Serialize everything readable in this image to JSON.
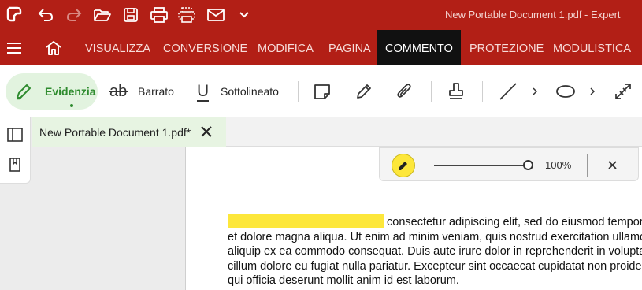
{
  "titlebar": {
    "document_title": "New Portable Document 1.pdf   -   Expert",
    "icons": [
      "app-logo-icon",
      "undo-icon",
      "redo-icon",
      "open-folder-icon",
      "save-icon",
      "print-icon",
      "scan-icon",
      "email-icon",
      "chevron-down-icon"
    ]
  },
  "menu": {
    "items": [
      "VISUALIZZA",
      "CONVERSIONE",
      "MODIFICA",
      "PAGINA",
      "COMMENTO",
      "PROTEZIONE",
      "MODULISTICA"
    ],
    "active": "COMMENTO"
  },
  "toolbar": {
    "highlight_label": "Evidenzia",
    "strikethrough_label": "Barrato",
    "underline_label": "Sottolineato",
    "strike_glyph": "ab",
    "underline_glyph": "U"
  },
  "tab": {
    "label": "New Portable Document 1.pdf*"
  },
  "highlight_panel": {
    "opacity": "100%",
    "color": "#fde73b"
  },
  "document": {
    "lines": [
      "consectetur adipiscing elit, sed do eiusmod tempor incididunt ut labore",
      "et dolore magna aliqua. Ut enim ad minim veniam, quis nostrud exercitation ullamco laboris nisi ut",
      "aliquip ex ea commodo consequat. Duis aute irure dolor in reprehenderit in voluptate velit esse",
      "cillum dolore eu fugiat nulla pariatur. Excepteur sint occaecat cupidatat non proident, sunt in culpa",
      "qui officia deserunt mollit anim id est laborum."
    ]
  },
  "colors": {
    "brand_red": "#b21f16",
    "active_green": "#2e8b2e",
    "highlight_yellow": "#fde73b"
  }
}
